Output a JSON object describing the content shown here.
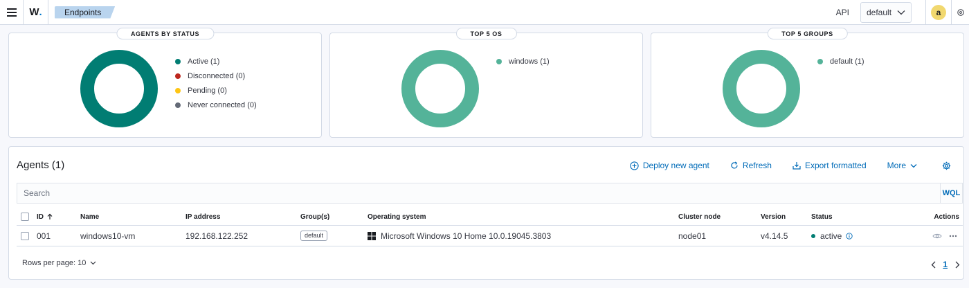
{
  "header": {
    "logo_letter": "W",
    "logo_dot": ".",
    "breadcrumb": "Endpoints",
    "api_label": "API",
    "space_select": "default",
    "avatar_initial": "a"
  },
  "panels": [
    {
      "title": "AGENTS BY STATUS",
      "legend": [
        {
          "label": "Active (1)",
          "color": "#017d73"
        },
        {
          "label": "Disconnected (0)",
          "color": "#bd271e"
        },
        {
          "label": "Pending (0)",
          "color": "#fec514"
        },
        {
          "label": "Never connected (0)",
          "color": "#646a77"
        }
      ],
      "donut_color": "#017d73"
    },
    {
      "title": "TOP 5 OS",
      "legend": [
        {
          "label": "windows (1)",
          "color": "#54b399"
        }
      ],
      "donut_color": "#54b399"
    },
    {
      "title": "TOP 5 GROUPS",
      "legend": [
        {
          "label": "default (1)",
          "color": "#54b399"
        }
      ],
      "donut_color": "#54b399"
    }
  ],
  "agents": {
    "title": "Agents (1)",
    "actions": {
      "deploy": "Deploy new agent",
      "refresh": "Refresh",
      "export": "Export formatted",
      "more": "More"
    },
    "search_placeholder": "Search",
    "wql_label": "WQL",
    "columns": {
      "id": "ID",
      "name": "Name",
      "ip": "IP address",
      "groups": "Group(s)",
      "os": "Operating system",
      "cluster": "Cluster node",
      "version": "Version",
      "status": "Status",
      "actions": "Actions"
    },
    "rows": [
      {
        "id": "001",
        "name": "windows10-vm",
        "ip": "192.168.122.252",
        "group": "default",
        "os": "Microsoft Windows 10 Home 10.0.19045.3803",
        "cluster": "node01",
        "version": "v4.14.5",
        "status": "active",
        "status_color": "#017d73"
      }
    ],
    "rows_per_page": "Rows per page: 10",
    "current_page": "1"
  },
  "colors": {
    "accent": "#006bb8",
    "breadcrumb_bg": "#b9d4ee",
    "avatar_bg": "#f1d86f"
  }
}
